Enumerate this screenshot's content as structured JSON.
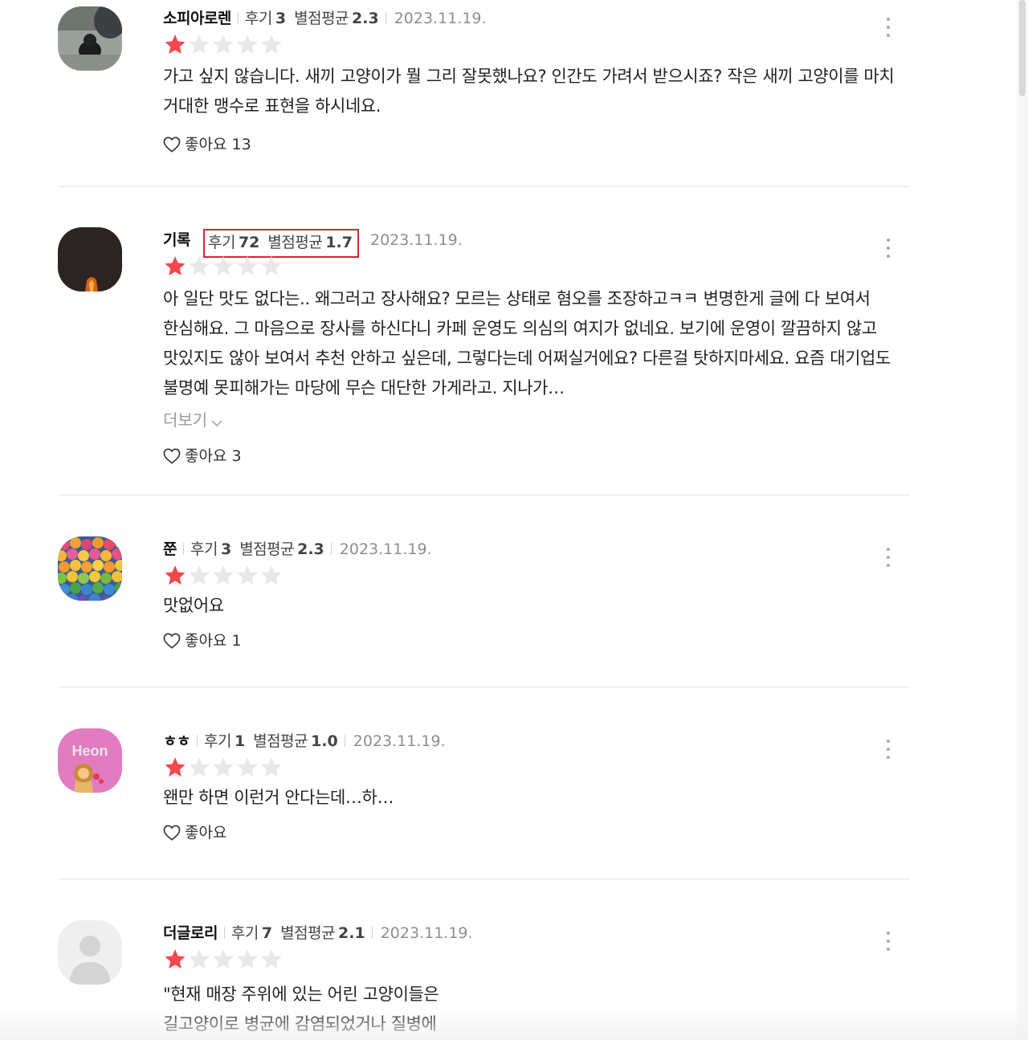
{
  "reviews": [
    {
      "nickname": "소피아로렌",
      "review_label": "후기",
      "review_count": "3",
      "rating_label": "별점평균",
      "rating_avg": "2.3",
      "date": "2023.11.19.",
      "stars_filled": 1,
      "stars_total": 5,
      "text": "가고 싶지 않습니다. 새끼 고양이가 뭘 그리 잘못했나요? 인간도 가려서 받으시죠? 작은 새끼 고양이를 마치 거대한 맹수로 표현을 하시네요.",
      "like_label": "좋아요",
      "like_count": "13",
      "avatar_icon": "cat-photo-avatar",
      "highlighted": false
    },
    {
      "nickname": "기록",
      "review_label": "후기",
      "review_count": "72",
      "rating_label": "별점평균",
      "rating_avg": "1.7",
      "date": "2023.11.19.",
      "stars_filled": 1,
      "stars_total": 5,
      "text": "아 일단 맛도 없다는.. 왜그러고 장사해요? 모르는 상태로 혐오를 조장하고ㅋㅋ 변명한게 글에 다 보여서 한심해요. 그 마음으로 장사를 하신다니 카페 운영도 의심의 여지가 없네요. 보기에 운영이 깔끔하지 않고 맛있지도 않아 보여서 추천 안하고 싶은데, 그렇다는데 어쩌실거에요? 다른걸 탓하지마세요. 요즘 대기업도 불명예 못피해가는 마당에 무슨 대단한 가게라고. 지나가…",
      "more_label": "더보기",
      "like_label": "좋아요",
      "like_count": "3",
      "avatar_icon": "dark-photo-avatar",
      "highlighted": true
    },
    {
      "nickname": "쭌",
      "review_label": "후기",
      "review_count": "3",
      "rating_label": "별점평균",
      "rating_avg": "2.3",
      "date": "2023.11.19.",
      "stars_filled": 1,
      "stars_total": 5,
      "text": "맛없어요",
      "like_label": "좋아요",
      "like_count": "1",
      "avatar_icon": "lanterns-photo-avatar",
      "highlighted": false
    },
    {
      "nickname": "ㅎㅎ",
      "review_label": "후기",
      "review_count": "1",
      "rating_label": "별점평균",
      "rating_avg": "1.0",
      "date": "2023.11.19.",
      "stars_filled": 1,
      "stars_total": 5,
      "text": "왠만 하면 이런거 안다는데…하…",
      "like_label": "좋아요",
      "like_count": "",
      "avatar_icon": "heon-character-avatar",
      "avatar_text": "Heon",
      "highlighted": false
    },
    {
      "nickname": "더글로리",
      "review_label": "후기",
      "review_count": "7",
      "rating_label": "별점평균",
      "rating_avg": "2.1",
      "date": "2023.11.19.",
      "stars_filled": 1,
      "stars_total": 5,
      "text": "\"현재 매장 주위에 있는 어린 고양이들은 길고양이로 병균에 감염되었거나 질병에",
      "like_label": "좋아요",
      "like_count": "",
      "avatar_icon": "default-user-avatar",
      "highlighted": false
    }
  ],
  "colors": {
    "star_filled": "#f5474f",
    "star_empty": "#e8e8e8",
    "highlight_box": "#d62631",
    "date_text": "#8e8e8e",
    "divider": "#e6e6e6"
  }
}
